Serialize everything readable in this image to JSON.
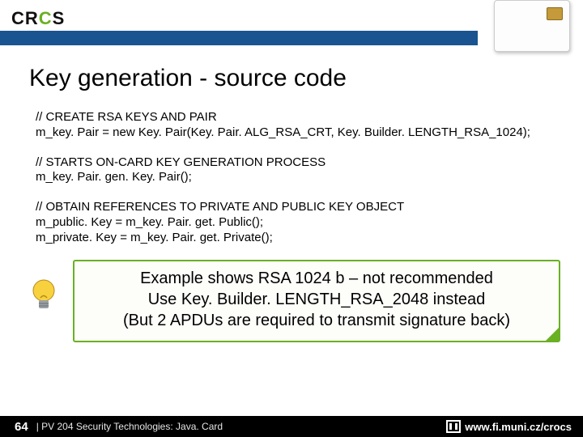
{
  "header": {
    "logo_left": "CR",
    "logo_mid": "C",
    "logo_right": "S"
  },
  "title": "Key generation - source code",
  "code": {
    "g1_c": "// CREATE RSA KEYS AND PAIR",
    "g1_l1": "m_key. Pair = new Key. Pair(Key. Pair. ALG_RSA_CRT, Key. Builder. LENGTH_RSA_1024);",
    "g2_c": "// STARTS ON-CARD KEY GENERATION PROCESS",
    "g2_l1": "m_key. Pair. gen. Key. Pair();",
    "g3_c": "// OBTAIN REFERENCES TO PRIVATE AND PUBLIC KEY OBJECT",
    "g3_l1": "m_public. Key = m_key. Pair. get. Public();",
    "g3_l2": "m_private. Key = m_key. Pair. get. Private();"
  },
  "note": {
    "line1": "Example shows RSA 1024 b – not recommended",
    "line2": "Use Key. Builder. LENGTH_RSA_2048 instead",
    "line3": "(But 2 APDUs are required to transmit signature back)"
  },
  "footer": {
    "page": "64",
    "course": "| PV 204 Security Technologies: Java. Card",
    "url": "www.fi.muni.cz/crocs"
  }
}
